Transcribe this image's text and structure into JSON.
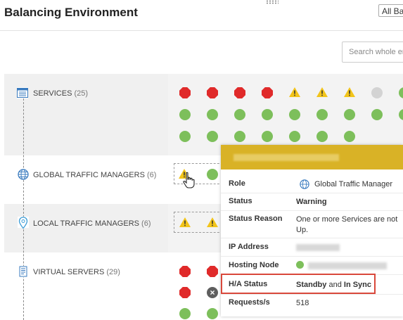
{
  "header": {
    "title": "Balancing Environment",
    "filter_label": "All Ba"
  },
  "search": {
    "placeholder": "Search whole en"
  },
  "categories": [
    {
      "label": "SERVICES",
      "count": "(25)",
      "icon": "services-list-icon"
    },
    {
      "label": "GLOBAL TRAFFIC MANAGERS",
      "count": "(6)",
      "icon": "globe-icon"
    },
    {
      "label": "LOCAL TRAFFIC MANAGERS",
      "count": "(6)",
      "icon": "location-pin-icon"
    },
    {
      "label": "VIRTUAL SERVERS",
      "count": "(29)",
      "icon": "document-icon"
    }
  ],
  "status_colors": {
    "critical": "#e02a2a",
    "warning": "#f2c41a",
    "ok": "#7dbf5b",
    "unknown": "#d3d3d3",
    "disabled": "#5e5e5e",
    "popup_header": "#d9b226",
    "highlight": "#d9483b"
  },
  "popup": {
    "rows": {
      "role": {
        "key": "Role",
        "value": "Global Traffic Manager",
        "icon": "globe-icon"
      },
      "status": {
        "key": "Status",
        "value": "Warning"
      },
      "status_reason": {
        "key": "Status Reason",
        "value": "One or more Services are not Up."
      },
      "ip_address": {
        "key": "IP Address"
      },
      "hosting_node": {
        "key": "Hosting Node"
      },
      "ha_status": {
        "key": "H/A Status",
        "value_a": "Standby",
        "value_and": "and",
        "value_b": "In Sync"
      },
      "requests": {
        "key": "Requests/s",
        "value": "518"
      }
    }
  }
}
